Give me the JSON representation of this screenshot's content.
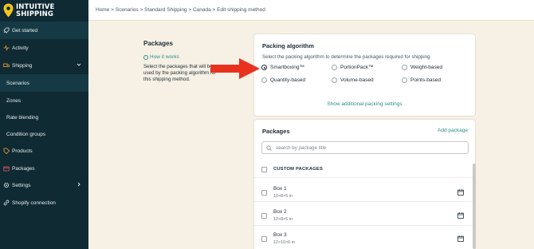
{
  "brand": {
    "line1": "INTUITIVE",
    "line2": "SHIPPING",
    "accent": "#f5c518"
  },
  "sidebar": {
    "items": [
      {
        "label": "Get started",
        "icon": "rocket-icon"
      },
      {
        "label": "Activity",
        "icon": "activity-icon"
      },
      {
        "label": "Shipping",
        "icon": "truck-icon",
        "expanded": true
      },
      {
        "label": "Scenarios"
      },
      {
        "label": "Zones"
      },
      {
        "label": "Rate blending"
      },
      {
        "label": "Condition groups"
      },
      {
        "label": "Products",
        "icon": "tag-icon"
      },
      {
        "label": "Packages",
        "icon": "box-icon"
      },
      {
        "label": "Settings",
        "icon": "gear-icon"
      },
      {
        "label": "Shopify connection",
        "icon": "link-icon"
      }
    ]
  },
  "breadcrumb": "Home > Scenarios > Standard Shipping > Canada > Edit shipping method",
  "section": {
    "title": "Packages",
    "help_link": "How it works",
    "description": "Select the packages that will be used by the packing algorithm for this shipping method."
  },
  "packing": {
    "title": "Packing algorithm",
    "subtitle": "Select the packing algorithm to determine the packages required for shipping.",
    "options": [
      "Smartboxing™",
      "PortionPack™",
      "Weight-based",
      "Quantity-based",
      "Volume-based",
      "Points-based"
    ],
    "selected": "Smartboxing™",
    "more_link": "Show additional packing settings"
  },
  "packages": {
    "title": "Packages",
    "add_link": "Add package",
    "search_placeholder": "search by package title",
    "column_header": "CUSTOM PACKAGES",
    "rows": [
      {
        "name": "Box 1",
        "dims": "10×8×5 in"
      },
      {
        "name": "Box 2",
        "dims": "12×8×5 in"
      },
      {
        "name": "Box 3",
        "dims": "12×10×6 in"
      }
    ]
  },
  "colors": {
    "sidebar": "#0f2a33",
    "background": "#f6f1e4",
    "link": "#2d8f92",
    "arrow": "#e8321e"
  }
}
